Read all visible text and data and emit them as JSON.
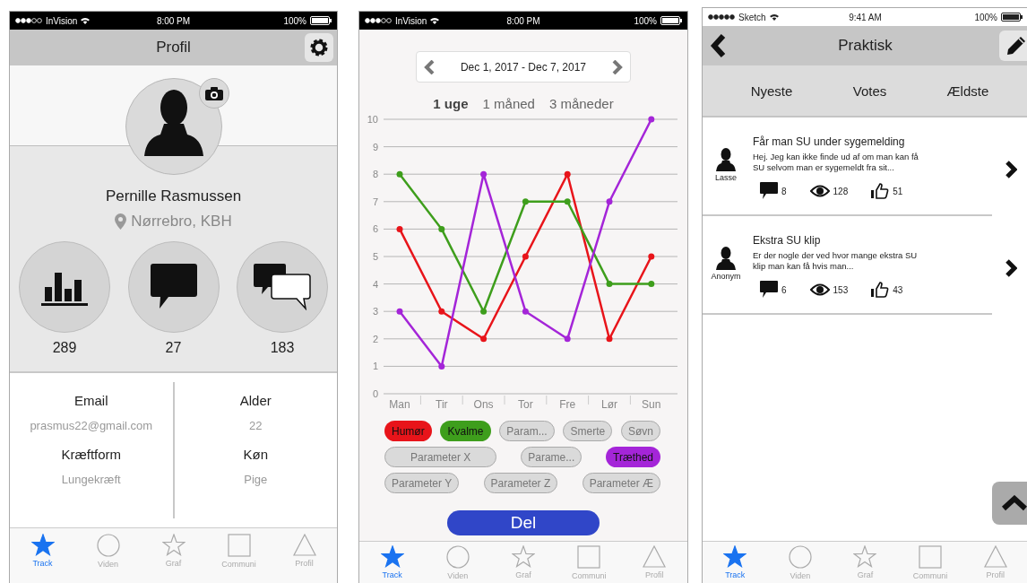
{
  "screens": [
    {
      "kind": "profile",
      "status_bar": {
        "kind": "dark",
        "carrier": "InVision",
        "time": "8:00 PM",
        "battery": "100%"
      },
      "header": {
        "title": "Profil"
      },
      "user": {
        "name": "Pernille Rasmussen",
        "location": "Nørrebro, KBH"
      },
      "stats": [
        {
          "kind": "chart",
          "count": "289"
        },
        {
          "kind": "bubble",
          "count": "27"
        },
        {
          "kind": "bubbles",
          "count": "183"
        }
      ],
      "info_columns": [
        [
          {
            "label": "Email",
            "value": "prasmus22@gmail.com"
          },
          {
            "label": "Kræftform",
            "value": "Lungekræft"
          }
        ],
        [
          {
            "label": "Alder",
            "value": "22"
          },
          {
            "label": "Køn",
            "value": "Pige"
          }
        ]
      ],
      "tab_bar": [
        {
          "kind": "star",
          "label": "Track",
          "selected": true
        },
        {
          "kind": "circle",
          "label": "Viden",
          "selected": false
        },
        {
          "kind": "star",
          "label": "Graf",
          "selected": false
        },
        {
          "kind": "square",
          "label": "Communi",
          "selected": false
        },
        {
          "kind": "triangle",
          "label": "Profil",
          "selected": false
        }
      ]
    },
    {
      "kind": "graph",
      "status_bar": {
        "kind": "dark",
        "carrier": "InVision",
        "time": "8:00 PM",
        "battery": "100%"
      },
      "date_range": "Dec 1, 2017 - Dec 7, 2017",
      "periods": [
        {
          "label": "1 uge",
          "selected": true
        },
        {
          "label": "1 måned",
          "selected": false
        },
        {
          "label": "3 måneder",
          "selected": false
        }
      ],
      "chart_data": {
        "type": "line",
        "categories": [
          "Man",
          "Tir",
          "Ons",
          "Tor",
          "Fre",
          "Lør",
          "Sun"
        ],
        "ylim": [
          0,
          10
        ],
        "grid": true,
        "yticks": [
          0,
          1,
          2,
          3,
          4,
          5,
          6,
          7,
          8,
          9,
          10
        ],
        "series": [
          {
            "color": "#e8141a",
            "marker": true,
            "values": [
              6,
              3,
              2,
              5,
              8,
              2,
              5
            ]
          },
          {
            "color": "#3e9e1c",
            "marker": true,
            "values": [
              8,
              6,
              3,
              7,
              7,
              4,
              4
            ]
          },
          {
            "color": "#a425d8",
            "marker": true,
            "values": [
              3,
              1,
              8,
              3,
              2,
              7,
              10
            ]
          }
        ]
      },
      "parameter_rows": [
        [
          {
            "label": "Humør",
            "selected": true,
            "color": "#e8141a"
          },
          {
            "label": "Kvalme",
            "selected": true,
            "color": "#3e9e1c"
          },
          {
            "label": "Param...",
            "selected": false
          },
          {
            "label": "Smerte",
            "selected": false
          },
          {
            "label": "Søvn",
            "selected": false
          }
        ],
        [
          {
            "label": "Parameter X",
            "selected": false
          },
          {
            "label": "Parame...",
            "selected": false
          },
          {
            "label": "Træthed",
            "selected": true,
            "color": "#a425d8"
          }
        ],
        [
          {
            "label": "Parameter Y",
            "selected": false
          },
          {
            "label": "Parameter Z",
            "selected": false
          },
          {
            "label": "Parameter Æ",
            "selected": false
          }
        ]
      ],
      "share_button": "Del",
      "tab_bar": [
        {
          "kind": "star",
          "label": "Track",
          "selected": true
        },
        {
          "kind": "circle",
          "label": "Viden",
          "selected": false
        },
        {
          "kind": "star",
          "label": "Graf",
          "selected": false
        },
        {
          "kind": "square",
          "label": "Communi",
          "selected": false
        },
        {
          "kind": "triangle",
          "label": "Profil",
          "selected": false
        }
      ]
    },
    {
      "kind": "forum",
      "status_bar": {
        "kind": "light",
        "carrier": "Sketch",
        "time": "9:41 AM",
        "battery": "100%"
      },
      "header": {
        "title": "Praktisk"
      },
      "sort_tabs": [
        {
          "label": "Nyeste",
          "selected": false
        },
        {
          "label": "Votes",
          "selected": false
        },
        {
          "label": "Ældste",
          "selected": false
        }
      ],
      "posts": [
        {
          "author": "Lasse",
          "title": "Får man SU under sygemelding",
          "excerpt": "Hej. Jeg kan ikke finde ud af om man kan få SU selvom man er sygemeldt fra sit...",
          "comments": "8",
          "views": "128",
          "likes": "51"
        },
        {
          "author": "Anonym",
          "title": "Ekstra SU klip",
          "excerpt": "Er der nogle der ved hvor mange ekstra SU klip man kan få hvis man...",
          "comments": "6",
          "views": "153",
          "likes": "43"
        }
      ],
      "tab_bar": [
        {
          "kind": "star",
          "label": "Track",
          "selected": true
        },
        {
          "kind": "circle",
          "label": "Viden",
          "selected": false
        },
        {
          "kind": "star",
          "label": "Graf",
          "selected": false
        },
        {
          "kind": "square",
          "label": "Communi",
          "selected": false
        },
        {
          "kind": "triangle",
          "label": "Profil",
          "selected": false
        }
      ]
    }
  ]
}
